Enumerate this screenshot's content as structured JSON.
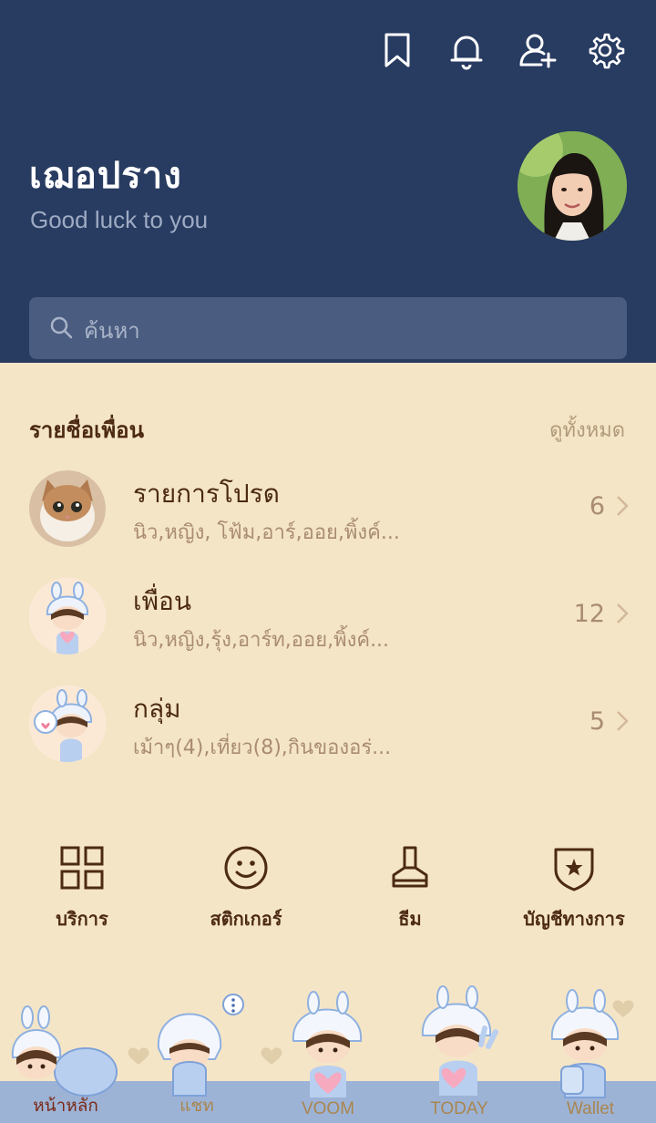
{
  "header": {
    "name": "เฌอปราง",
    "status_message": "Good luck to you",
    "icons": [
      "bookmark-icon",
      "bell-icon",
      "add-friend-icon",
      "settings-icon"
    ],
    "bg_color": "#283b61"
  },
  "search": {
    "placeholder": "ค้นหา"
  },
  "friends_section": {
    "title": "รายชื่อเพื่อน",
    "see_all": "ดูทั้งหมด",
    "rows": [
      {
        "title": "รายการโปรด",
        "subtitle": "นิว,หญิง, โฟ้ม,อาร์,ออย,พิ้งค์...",
        "count": "6"
      },
      {
        "title": "เพื่อน",
        "subtitle": "นิว,หญิง,รุ้ง,อาร์ท,ออย,พิ้งค์...",
        "count": "12"
      },
      {
        "title": "กลุ่ม",
        "subtitle": "เม้าๆ(4),เที่ยว(8),กินของอร่...",
        "count": "5"
      }
    ]
  },
  "menu": [
    {
      "label": "บริการ",
      "icon": "grid-icon"
    },
    {
      "label": "สติกเกอร์",
      "icon": "smile-icon"
    },
    {
      "label": "ธีม",
      "icon": "brush-icon"
    },
    {
      "label": "บัญชีทางการ",
      "icon": "shield-star-icon"
    }
  ],
  "tabs": [
    {
      "label": "หน้าหลัก",
      "active": true
    },
    {
      "label": "แชท",
      "active": false
    },
    {
      "label": "VOOM",
      "active": false
    },
    {
      "label": "TODAY",
      "active": false
    },
    {
      "label": "Wallet",
      "active": false
    }
  ],
  "colors": {
    "background": "#f5e5c7",
    "text_dark": "#4c2a13",
    "text_muted": "#a98c71",
    "tab_strip": "#9db3d6"
  }
}
